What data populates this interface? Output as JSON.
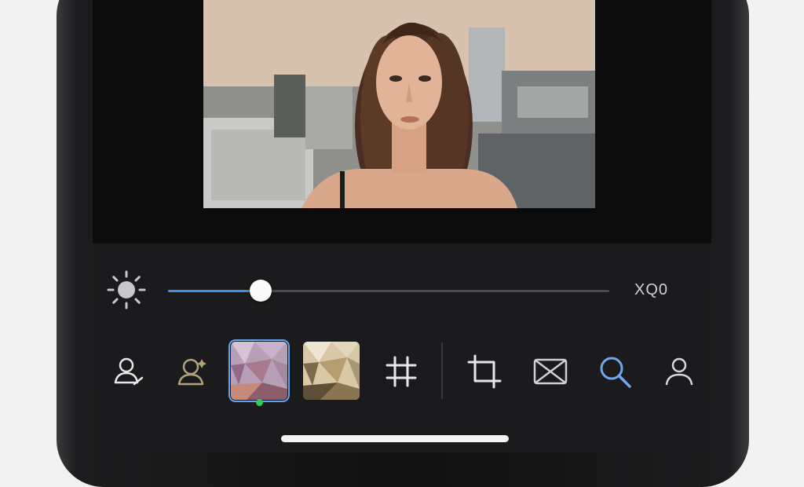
{
  "adjustment": {
    "icon": "brightness-icon",
    "slider_level_percent": 21,
    "value_label": "XQ0",
    "accent_color": "#3e8fe6"
  },
  "toolbar": {
    "tools": [
      {
        "id": "portrait",
        "icon": "person-edit-icon"
      },
      {
        "id": "face-retouch",
        "icon": "person-sparkle-icon"
      },
      {
        "id": "filter-1",
        "icon": "filter-thumbnail",
        "selected": true
      },
      {
        "id": "filter-2",
        "icon": "filter-thumbnail"
      },
      {
        "id": "grid",
        "icon": "grid-icon"
      },
      {
        "id": "crop",
        "icon": "crop-icon"
      },
      {
        "id": "frame",
        "icon": "frame-x-icon"
      },
      {
        "id": "search",
        "icon": "search-icon",
        "active": true
      },
      {
        "id": "profile",
        "icon": "person-icon"
      }
    ],
    "selected_indicator_color": "#34c759"
  }
}
